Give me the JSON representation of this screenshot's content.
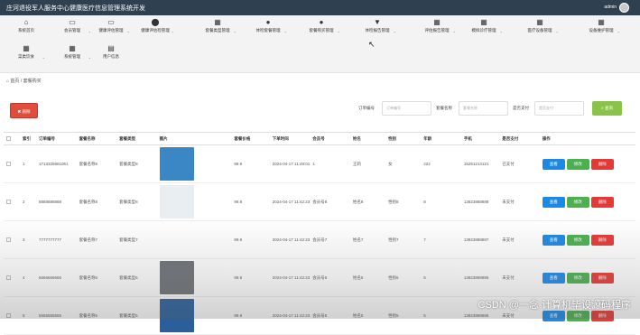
{
  "header": {
    "title": "庄河退役军人服务中心健康医疗信息管理系统开发",
    "username": "admin"
  },
  "nav": {
    "items": [
      {
        "icon": "⌂",
        "label": "系统首页",
        "dd": false
      },
      {
        "icon": "▭",
        "label": "会员管理",
        "dd": true
      },
      {
        "icon": "▭",
        "label": "健康评估管理",
        "dd": true
      },
      {
        "icon": "⬤",
        "label": "健康评估检管理",
        "dd": true
      },
      {
        "icon": "▦",
        "label": "套餐类型管理",
        "dd": true
      },
      {
        "icon": "●",
        "label": "体检套餐管理",
        "dd": true
      },
      {
        "icon": "●",
        "label": "套餐购买管理",
        "dd": true
      },
      {
        "icon": "▼",
        "label": "体检报告管理",
        "dd": true
      },
      {
        "icon": "▦",
        "label": "评估报告管理",
        "dd": true
      },
      {
        "icon": "▦",
        "label": "模拟诊疗管理",
        "dd": true
      },
      {
        "icon": "▦",
        "label": "医疗设备管理",
        "dd": true
      },
      {
        "icon": "▦",
        "label": "设备维护管理",
        "dd": true
      },
      {
        "icon": "▦",
        "label": "菜类饮食",
        "dd": true
      },
      {
        "icon": "▦",
        "label": "系统管理",
        "dd": true
      },
      {
        "icon": "▤",
        "label": "用户信息",
        "dd": false
      }
    ]
  },
  "breadcrumb": {
    "home": "首页",
    "sep": "/",
    "current": "套餐购买"
  },
  "toolbar": {
    "delete": "删除",
    "order_label": "订单编号",
    "order_placeholder": "订单编号",
    "name_label": "套餐名称",
    "name_placeholder": "套餐名称",
    "pay_label": "是否支付",
    "pay_placeholder": "是否支付",
    "search": "查询"
  },
  "table": {
    "headers": [
      "",
      "索引",
      "订单编号",
      "套餐名称",
      "套餐类型",
      "图片",
      "套餐价格",
      "下单时间",
      "会员号",
      "姓名",
      "性别",
      "年龄",
      "手机",
      "是否支付",
      "操作"
    ],
    "rows": [
      {
        "idx": "1",
        "order": "1713325681061",
        "name": "套餐名称8",
        "type": "套餐类型8",
        "price": "99.9",
        "time": "2024-04-17 11:48:01",
        "member": "1",
        "person": "王莉",
        "sex": "女",
        "age": "222",
        "phone": "15251214121",
        "paid": "已支付",
        "img": "#3b86c4"
      },
      {
        "idx": "2",
        "order": "8888888888",
        "name": "套餐名称8",
        "type": "套餐类型8",
        "price": "99.9",
        "time": "2024-04-17 11:42:23",
        "member": "会员号8",
        "person": "姓名8",
        "sex": "性别8",
        "age": "8",
        "phone": "13823888888",
        "paid": "未支付",
        "img": "#e9eef3"
      },
      {
        "idx": "3",
        "order": "7777777777",
        "name": "套餐名称7",
        "type": "套餐类型7",
        "price": "99.9",
        "time": "2024-04-17 11:42:23",
        "member": "会员号7",
        "person": "姓名7",
        "sex": "性别7",
        "age": "7",
        "phone": "13823888887",
        "paid": "未支付",
        "img": ""
      },
      {
        "idx": "4",
        "order": "6666666666",
        "name": "套餐名称6",
        "type": "套餐类型6",
        "price": "99.9",
        "time": "2024-04-17 11:42:23",
        "member": "会员号6",
        "person": "姓名6",
        "sex": "性别6",
        "age": "6",
        "phone": "13823888886",
        "paid": "未支付",
        "img": "#6d7175"
      },
      {
        "idx": "5",
        "order": "5555555555",
        "name": "套餐名称5",
        "type": "套餐类型5",
        "price": "99.9",
        "time": "2024-04-17 11:42:23",
        "member": "会员号5",
        "person": "姓名5",
        "sex": "性别5",
        "age": "5",
        "phone": "13823888885",
        "paid": "未支付",
        "img": "#2a5f9c"
      }
    ],
    "actions": {
      "view": "查看",
      "edit": "修改",
      "delete": "删除"
    }
  },
  "watermark": "CSDN @一念 计算机毕设源码程序"
}
